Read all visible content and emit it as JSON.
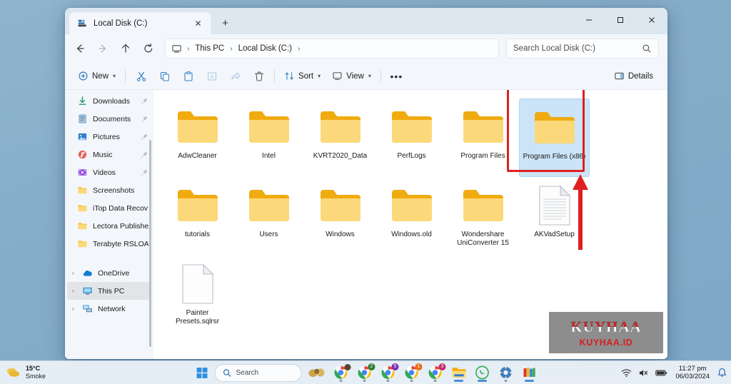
{
  "desktop": {
    "background_color": "#85adc9"
  },
  "window": {
    "tab": {
      "title": "Local Disk (C:)",
      "icon": "disk-icon",
      "close_label": "✕",
      "newtab_label": "+"
    },
    "controls": {
      "minimize": "─",
      "maximize": "□",
      "close": "✕"
    },
    "address_bar": {
      "back": "←",
      "forward": "→",
      "up": "↑",
      "refresh": "⟳",
      "crumb_icon": "this-pc-icon",
      "crumbs": [
        "This PC",
        "Local Disk (C:)"
      ],
      "separator": "›",
      "trailing_separator": "›"
    },
    "search": {
      "placeholder": "Search Local Disk (C:)",
      "icon": "search-icon"
    },
    "command_bar": {
      "new_label": "New",
      "cut_label": "Cut",
      "copy_label": "Copy",
      "paste_label": "Paste",
      "rename_label": "Rename",
      "share_label": "Share",
      "delete_label": "Delete",
      "sort_label": "Sort",
      "view_label": "View",
      "more_label": "•••",
      "details_label": "Details",
      "chevron": "▾"
    }
  },
  "sidebar": {
    "quick_items": [
      {
        "label": "Downloads",
        "icon": "downloads-icon",
        "pinned": true
      },
      {
        "label": "Documents",
        "icon": "documents-icon",
        "pinned": true
      },
      {
        "label": "Pictures",
        "icon": "pictures-icon",
        "pinned": true
      },
      {
        "label": "Music",
        "icon": "music-icon",
        "pinned": true
      },
      {
        "label": "Videos",
        "icon": "videos-icon",
        "pinned": true
      },
      {
        "label": "Screenshots",
        "icon": "folder-icon",
        "pinned": false
      },
      {
        "label": "iTop Data Recov",
        "icon": "folder-icon",
        "pinned": false
      },
      {
        "label": "Lectora Publishe",
        "icon": "folder-icon",
        "pinned": false
      },
      {
        "label": "Terabyte RSLOA",
        "icon": "folder-icon",
        "pinned": false
      }
    ],
    "root_items": [
      {
        "label": "OneDrive",
        "icon": "onedrive-icon",
        "selected": false
      },
      {
        "label": "This PC",
        "icon": "this-pc-icon",
        "selected": true
      },
      {
        "label": "Network",
        "icon": "network-icon",
        "selected": false
      }
    ],
    "expand_arrow": "›"
  },
  "content": {
    "items": [
      {
        "name": "AdwCleaner",
        "type": "folder",
        "selected": false
      },
      {
        "name": "Intel",
        "type": "folder",
        "selected": false
      },
      {
        "name": "KVRT2020_Data",
        "type": "folder",
        "selected": false
      },
      {
        "name": "PerfLogs",
        "type": "folder",
        "selected": false
      },
      {
        "name": "Program Files",
        "type": "folder",
        "selected": false
      },
      {
        "name": "Program Files (x86)",
        "type": "folder",
        "selected": true
      },
      {
        "name": "tutorials",
        "type": "folder",
        "selected": false
      },
      {
        "name": "Users",
        "type": "folder",
        "selected": false
      },
      {
        "name": "Windows",
        "type": "folder",
        "selected": false
      },
      {
        "name": "Windows.old",
        "type": "folder",
        "selected": false
      },
      {
        "name": "Wondershare UniConverter 15",
        "type": "folder",
        "selected": false
      },
      {
        "name": "AKVadSetup",
        "type": "text-file",
        "selected": false
      },
      {
        "name": "Painter Presets.sqlrsr",
        "type": "blank-file",
        "selected": false
      }
    ]
  },
  "annotations": {
    "highlight_color": "#e02020",
    "rectangle_target": "Program Files (x86)",
    "arrow_direction": "up"
  },
  "watermark": {
    "top_text": "KUYHAA",
    "bottom_text": "KUYHAA.ID"
  },
  "taskbar": {
    "weather": {
      "temperature": "15°C",
      "condition": "Smoke",
      "icon": "smoke-weather-icon"
    },
    "start_label": "Start",
    "search": {
      "placeholder": "Search",
      "icon": "search-icon"
    },
    "apps": [
      {
        "name": "pinned-app",
        "icon": "paint-app-icon",
        "badge": "",
        "active": false
      },
      {
        "name": "chrome-window-1",
        "icon": "chrome-icon",
        "badge": "",
        "active": true
      },
      {
        "name": "chrome-window-2",
        "icon": "chrome-icon",
        "badge": "2",
        "active": true
      },
      {
        "name": "chrome-window-3",
        "icon": "chrome-icon",
        "badge": "5",
        "active": true
      },
      {
        "name": "chrome-window-4",
        "icon": "chrome-icon",
        "badge": "1",
        "active": true
      },
      {
        "name": "chrome-window-5",
        "icon": "chrome-icon",
        "badge": "3",
        "active": true
      },
      {
        "name": "file-explorer",
        "icon": "folder-icon",
        "badge": "",
        "active": true
      },
      {
        "name": "whatsapp",
        "icon": "whatsapp-icon",
        "badge": "",
        "active": true
      },
      {
        "name": "settings",
        "icon": "gear-icon",
        "badge": "",
        "active": true
      },
      {
        "name": "winrar",
        "icon": "winrar-icon",
        "badge": "",
        "active": true
      }
    ],
    "tray": {
      "network_icon": "wifi-icon",
      "volume_icon": "volume-muted-icon",
      "battery_icon": "battery-icon",
      "notifications_icon": "bell-icon"
    },
    "clock": {
      "time": "11:27 pm",
      "date": "06/03/2024"
    }
  }
}
